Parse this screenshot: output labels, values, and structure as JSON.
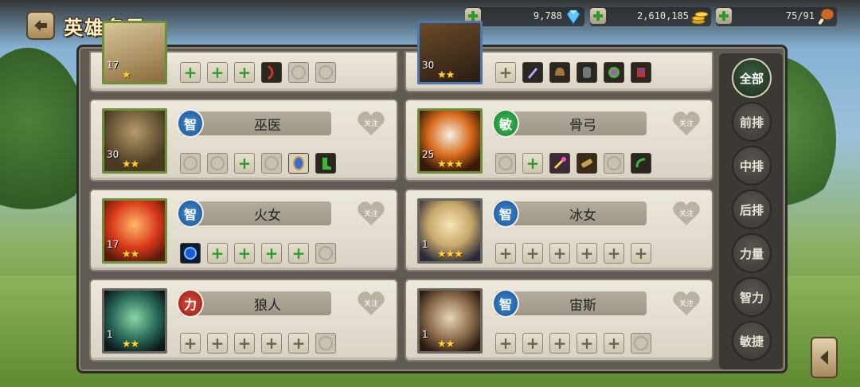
{
  "header": {
    "title": "英雄名录",
    "resources": [
      {
        "name": "gem",
        "value": "9,788",
        "icon": "diamond-icon"
      },
      {
        "name": "gold",
        "value": "2,610,185",
        "icon": "coin-stack-icon"
      },
      {
        "name": "stamina",
        "value": "75/91",
        "icon": "drumstick-icon"
      }
    ]
  },
  "filter_tabs": [
    "全部",
    "前排",
    "中排",
    "后排",
    "力量",
    "智力",
    "敏捷"
  ],
  "active_tab": "全部",
  "fav_label": "关注",
  "heroes": [
    {
      "name": "",
      "type": "",
      "level": "17",
      "stars": "★",
      "partial": true
    },
    {
      "name": "",
      "type": "",
      "level": "30",
      "stars": "★★",
      "partial": true
    },
    {
      "name": "巫医",
      "type": "智",
      "level": "30",
      "stars": "★★"
    },
    {
      "name": "骨弓",
      "type": "敏",
      "level": "25",
      "stars": "★★★"
    },
    {
      "name": "火女",
      "type": "智",
      "level": "17",
      "stars": "★★"
    },
    {
      "name": "冰女",
      "type": "智",
      "level": "1",
      "stars": "★★★"
    },
    {
      "name": "狼人",
      "type": "力",
      "level": "1",
      "stars": "★★"
    },
    {
      "name": "宙斯",
      "type": "智",
      "level": "1",
      "stars": "★★"
    }
  ],
  "colors": {
    "str": "#e04a3a",
    "int": "#3b8fd6",
    "agi": "#3fc45a"
  }
}
